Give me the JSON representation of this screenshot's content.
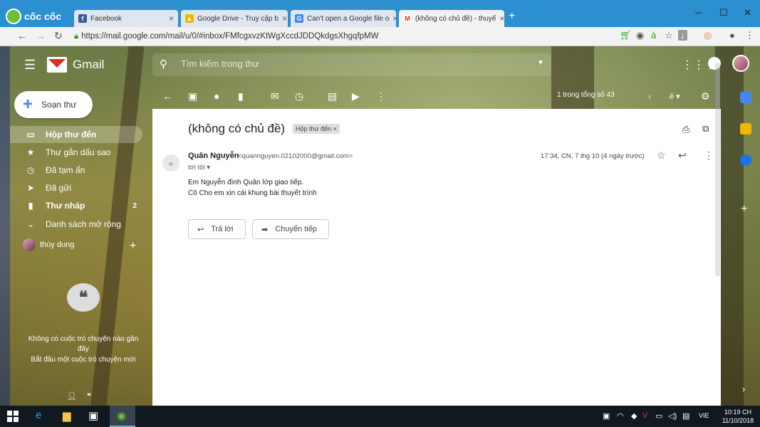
{
  "browser": {
    "logo_text": "cốc cốc",
    "tabs": [
      {
        "label": "Facebook",
        "favicon_color": "#3b5998",
        "favicon_letter": "f"
      },
      {
        "label": "Google Drive - Truy cập b",
        "favicon_color": "#f4b400",
        "favicon_letter": "▲"
      },
      {
        "label": "Can't open a Google file o",
        "favicon_color": "#4285f4",
        "favicon_letter": "G"
      },
      {
        "label": "(không có chủ đề) - thuyế",
        "favicon_color": "#d93025",
        "favicon_letter": "M"
      }
    ],
    "close_glyph": "×",
    "new_tab": "+",
    "url": "https://mail.google.com/mail/u/0/#inbox/FMfcgxvzKtWgXccdJDDQkdgsXhgqfpMW"
  },
  "gmail": {
    "product_name": "Gmail",
    "search_placeholder": "Tìm kiếm trong thư",
    "compose_label": "Soạn thư",
    "nav": [
      {
        "label": "Hộp thư đến",
        "icon": "inbox-icon",
        "glyph": "▭",
        "count": ""
      },
      {
        "label": "Thư gắn dấu sao",
        "icon": "star-icon",
        "glyph": "★",
        "count": ""
      },
      {
        "label": "Đã tạm ẩn",
        "icon": "clock-icon",
        "glyph": "◷",
        "count": ""
      },
      {
        "label": "Đã gửi",
        "icon": "send-icon",
        "glyph": "➤",
        "count": ""
      },
      {
        "label": "Thư nháp",
        "icon": "draft-icon",
        "glyph": "▮",
        "count": "2"
      },
      {
        "label": "Danh sách mở rộng",
        "icon": "chevron-down-icon",
        "glyph": "⌄",
        "count": ""
      }
    ],
    "hangouts_user": "thùy dung",
    "no_chats_line1": "Không có cuộc trò chuyện nào gần đây",
    "no_chats_line2": "Bắt đầu một cuộc trò chuyện mới",
    "pager_text": "1 trong tổng số 43",
    "message": {
      "subject": "(không có chủ đề)",
      "label": "Hộp thư đến",
      "sender_name": "Quân Nguyễn",
      "sender_email": "<quannguyen.02102000@gmail.com>",
      "to_line": "tới tôi",
      "timestamp": "17:34, CN, 7 thg 10 (4 ngày trước)",
      "body_lines": [
        "Em Nguyễn đình Quân lớp giao tiếp.",
        "Cô Cho em xin cái khung bài thuyết trình"
      ],
      "reply_label": "Trả lời",
      "forward_label": "Chuyển tiếp"
    }
  },
  "taskbar": {
    "language": "VIE",
    "time": "10:19 CH",
    "date": "11/10/2018"
  }
}
